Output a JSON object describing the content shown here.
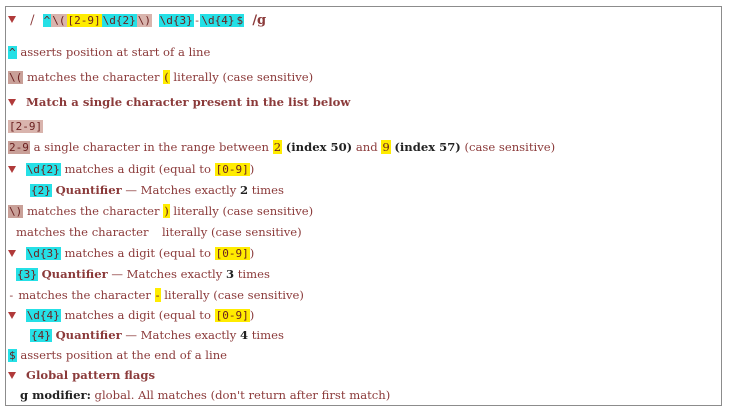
{
  "header": {
    "delim_open": "/",
    "regex_caret": "^",
    "regex_esc_open": "\\(",
    "regex_class": "[2-9]",
    "regex_d2": "\\d{2}",
    "regex_esc_close": "\\)",
    "regex_space": " ",
    "regex_d3": "\\d{3}",
    "regex_dash": "-",
    "regex_d4": "\\d{4}",
    "regex_dollar": "$",
    "delim_close": "/g"
  },
  "lines": {
    "caret_token": "^",
    "caret_text": "asserts position at start of a line",
    "lparen_token": "\\(",
    "lparen_text_a": "matches the character",
    "lparen_char": "(",
    "lparen_text_b": "literally (case sensitive)",
    "set_heading": "Match a single character present in the list below",
    "set_token": "[2-9]",
    "range_token": "2-9",
    "range_text_a": "a single character in the range between",
    "range_lo": "2",
    "range_lo_index": "(index 50)",
    "range_and": "and",
    "range_hi": "9",
    "range_hi_index": "(index 57)",
    "range_text_b": "(case sensitive)",
    "d2_token": "\\d{2}",
    "d2_text": "matches a digit (equal to",
    "d2_class": "[0-9]",
    "d2_close": ")",
    "q2_token": "{2}",
    "q2_label": "Quantifier",
    "q2_text_a": "— Matches exactly",
    "q2_num": "2",
    "q2_text_b": "times",
    "rparen_token": "\\)",
    "rparen_text_a": "matches the character",
    "rparen_char": ")",
    "rparen_text_b": "literally (case sensitive)",
    "space_text_a": "matches the character",
    "space_text_b": "literally (case sensitive)",
    "d3_token": "\\d{3}",
    "d3_text": "matches a digit (equal to",
    "d3_class": "[0-9]",
    "d3_close": ")",
    "q3_token": "{3}",
    "q3_label": "Quantifier",
    "q3_text_a": "— Matches exactly",
    "q3_num": "3",
    "q3_text_b": "times",
    "dash_token": "-",
    "dash_text_a": "matches the character",
    "dash_char": "-",
    "dash_text_b": "literally (case sensitive)",
    "d4_token": "\\d{4}",
    "d4_text": "matches a digit (equal to",
    "d4_class": "[0-9]",
    "d4_close": ")",
    "q4_token": "{4}",
    "q4_label": "Quantifier",
    "q4_text_a": "— Matches exactly",
    "q4_num": "4",
    "q4_text_b": "times",
    "dollar_token": "$",
    "dollar_text": "asserts position at the end of a line",
    "flags_heading": "Global pattern flags",
    "g_label": "g modifier:",
    "g_text": "global. All matches (don't return after first match)"
  }
}
